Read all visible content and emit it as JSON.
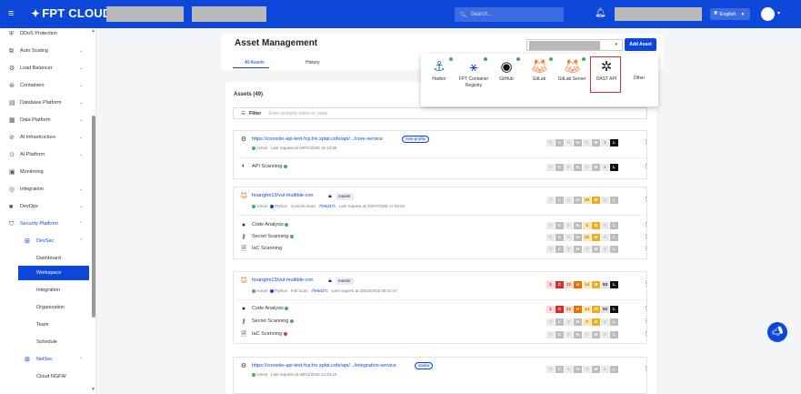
{
  "header": {
    "brand": "FPT CLOUD",
    "search_placeholder": "Search...",
    "language": "English"
  },
  "sidebar": {
    "items": [
      {
        "label": "DDoS Protection"
      },
      {
        "label": "Auto Scaling"
      },
      {
        "label": "Load Balancer"
      },
      {
        "label": "Containers"
      },
      {
        "label": "Database Platform"
      },
      {
        "label": "Data Platform"
      },
      {
        "label": "AI Infrastructure"
      },
      {
        "label": "AI Platform"
      },
      {
        "label": "Monitoring"
      },
      {
        "label": "Integration"
      },
      {
        "label": "DevOps"
      },
      {
        "label": "Security Platform"
      },
      {
        "label": "DevSec"
      },
      {
        "label": "Dashboard"
      },
      {
        "label": "Workspace"
      },
      {
        "label": "Integration"
      },
      {
        "label": "Organization"
      },
      {
        "label": "Team"
      },
      {
        "label": "Schedule"
      },
      {
        "label": "NetSec"
      },
      {
        "label": "Cloud NGFW"
      }
    ]
  },
  "page": {
    "title": "Asset Management",
    "tabs": [
      "All Assets",
      "History"
    ],
    "add_button": "Add Asset",
    "assets_title": "Assets (49)",
    "filter_label": "Filter",
    "filter_placeholder": "Enter property name or value"
  },
  "popup": {
    "items": [
      {
        "label": "Harbor"
      },
      {
        "label": "FPT Container Registry"
      },
      {
        "label": "GitHub"
      },
      {
        "label": "GitLab"
      },
      {
        "label": "GitLab Server"
      },
      {
        "label": "DAST API"
      },
      {
        "label": "Other"
      }
    ]
  },
  "assets": [
    {
      "name": "https://console-api-test-fcp.fre.xplat.cofe/api/.../core-service",
      "tag": "new-profile",
      "meta_status": "Active",
      "meta_extra": "Last request at 29/07/2026 16:13:45",
      "scans": [
        {
          "label": "API Scanning",
          "sev": [
            "0",
            "C",
            "0",
            "H",
            "M",
            "L",
            "0"
          ]
        }
      ],
      "sev": [
        "0",
        "C",
        "0",
        "H",
        "0",
        "M",
        "1",
        "L"
      ]
    },
    {
      "name": "hoangtm13/vul-multible-con",
      "branch": "master",
      "meta_status": "Active",
      "meta_lang": "Python",
      "meta_commit": "Commit Scan",
      "meta_hash": "7fe6d37c",
      "meta_time": "Last request at 20/07/2026 17:46:52",
      "scans": [
        {
          "label": "Code Analysis"
        },
        {
          "label": "Secret Scanning"
        },
        {
          "label": "IaC Scanning"
        }
      ],
      "sev": [
        "0",
        "C",
        "0",
        "H",
        "26",
        "M",
        "0",
        "L"
      ]
    },
    {
      "name": "hoangtm13/vul-multible-con",
      "branch": "master",
      "meta_status": "Active",
      "meta_lang": "Python",
      "meta_commit": "Full Scan",
      "meta_hash": "7fe6d37c",
      "meta_time": "Last request at 29/02/2026 09:22:47",
      "scans": [
        {
          "label": "Code Analysis"
        },
        {
          "label": "Secret Scanning"
        },
        {
          "label": "IaC Scanning"
        }
      ],
      "sev": [
        "1",
        "C",
        "22",
        "H",
        "14",
        "M",
        "53",
        "L"
      ]
    },
    {
      "name": "https://console-api-test-fcp.fre.xplat.cofe/api/.../integration-service",
      "tag": "saoka",
      "meta_status": "Active",
      "meta_extra": "Last request at 09/01/2026 14:34:19"
    }
  ]
}
